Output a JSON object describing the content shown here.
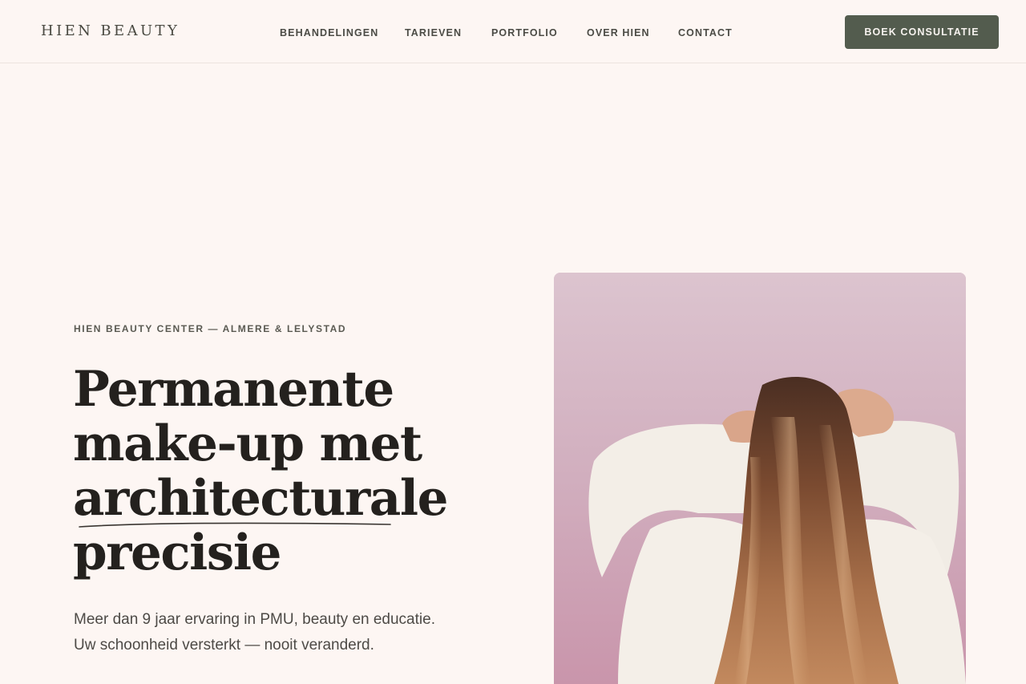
{
  "header": {
    "logo": "HIEN BEAUTY",
    "nav": [
      {
        "label": "BEHANDELINGEN"
      },
      {
        "label": "TARIEVEN"
      },
      {
        "label": "PORTFOLIO"
      },
      {
        "label": "OVER HIEN"
      },
      {
        "label": "CONTACT"
      }
    ],
    "cta_label": "BOEK CONSULTATIE"
  },
  "hero": {
    "eyebrow": "HIEN BEAUTY CENTER — ALMERE & LELYSTAD",
    "headline_lines": [
      "Permanente",
      "make-up met",
      "architecturale",
      "precisie"
    ],
    "lede_lines": [
      "Meer dan 9 jaar ervaring in PMU, beauty en educatie.",
      "Uw schoonheid versterkt — nooit veranderd."
    ],
    "image_subject": "woman-with-long-wavy-hair-from-behind"
  },
  "colors": {
    "background": "#fdf6f3",
    "accent": "#535c4e",
    "text": "#24211e",
    "photo_backdrop": "#d4b3c2"
  }
}
